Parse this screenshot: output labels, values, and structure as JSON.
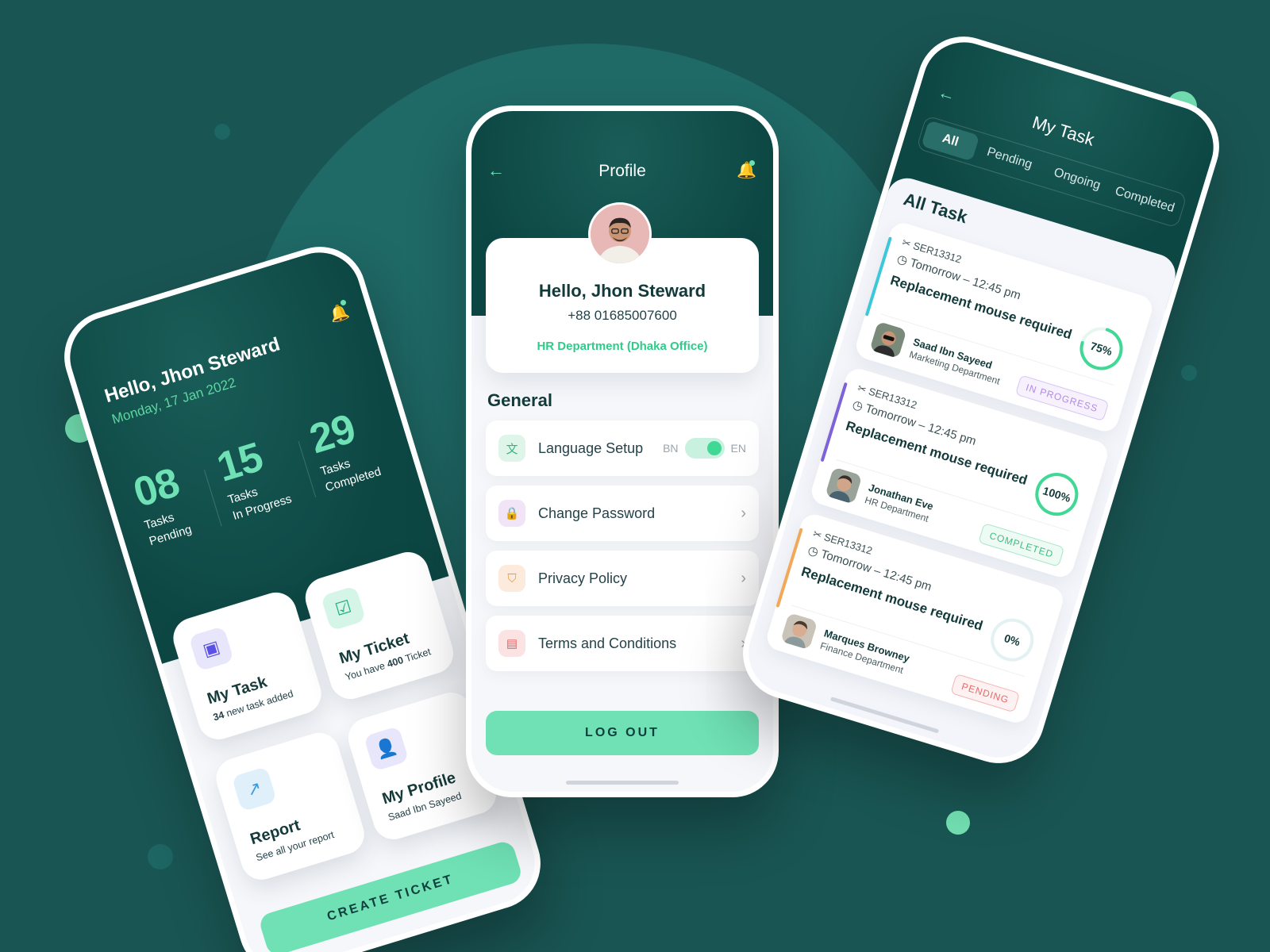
{
  "colors": {
    "background": "#195553",
    "accent": "#6fe1b4",
    "header_dark": "#0d4744",
    "in_progress": "#b48ae6",
    "completed": "#3fd894",
    "pending": "#f07b7b"
  },
  "dashboard": {
    "greeting": "Hello, Jhon Steward",
    "date": "Monday, 17 Jan 2022",
    "bell_icon": "bell-icon",
    "stats": [
      {
        "value": "08",
        "label_line1": "Tasks",
        "label_line2": "Pending"
      },
      {
        "value": "15",
        "label_line1": "Tasks",
        "label_line2": "In Progress"
      },
      {
        "value": "29",
        "label_line1": "Tasks",
        "label_line2": "Completed"
      }
    ],
    "tiles": {
      "my_task": {
        "title": "My Task",
        "count": "34",
        "subtitle": "new task added",
        "icon": "task-box-icon"
      },
      "my_ticket": {
        "title": "My Ticket",
        "prefix": "You have",
        "count": "400",
        "suffix": "Ticket",
        "icon": "clipboard-list-icon"
      },
      "report": {
        "title": "Report",
        "subtitle": "See all your report",
        "icon": "report-chart-icon"
      },
      "my_profile": {
        "title": "My Profile",
        "subtitle": "Saad Ibn Sayeed",
        "icon": "user-badge-icon"
      }
    },
    "create_button": "CREATE TICKET"
  },
  "profile": {
    "title": "Profile",
    "name": "Hello, Jhon Steward",
    "phone": "+88 01685007600",
    "department": "HR Department (Dhaka Office)",
    "section_title": "General",
    "settings": [
      {
        "label": "Language Setup",
        "icon": "translate-icon"
      },
      {
        "label": "Change Password",
        "icon": "lock-icon"
      },
      {
        "label": "Privacy Policy",
        "icon": "shield-icon"
      },
      {
        "label": "Terms and Conditions",
        "icon": "document-icon"
      }
    ],
    "language_toggle": {
      "left": "BN",
      "right": "EN"
    },
    "logout": "LOG OUT"
  },
  "my_task": {
    "title": "My Task",
    "tabs": [
      "All",
      "Pending",
      "Ongoing",
      "Completed"
    ],
    "active_tab": "All",
    "section_title": "All Task",
    "tasks": [
      {
        "id": "SER13312",
        "time": "Tomorrow – 12:45 pm",
        "title": "Replacement mouse required",
        "progress": "75%",
        "progress_value": 0.75,
        "person": "Saad Ibn Sayeed",
        "department": "Marketing Department",
        "status": "IN PROGRESS"
      },
      {
        "id": "SER13312",
        "time": "Tomorrow – 12:45 pm",
        "title": "Replacement mouse required",
        "progress": "100%",
        "progress_value": 1.0,
        "person": "Jonathan Eve",
        "department": "HR Department",
        "status": "COMPLETED"
      },
      {
        "id": "SER13312",
        "time": "Tomorrow – 12:45 pm",
        "title": "Replacement mouse required",
        "progress": "0%",
        "progress_value": 0.0,
        "person": "Marques Browney",
        "department": "Finance Department",
        "status": "PENDING"
      }
    ]
  }
}
